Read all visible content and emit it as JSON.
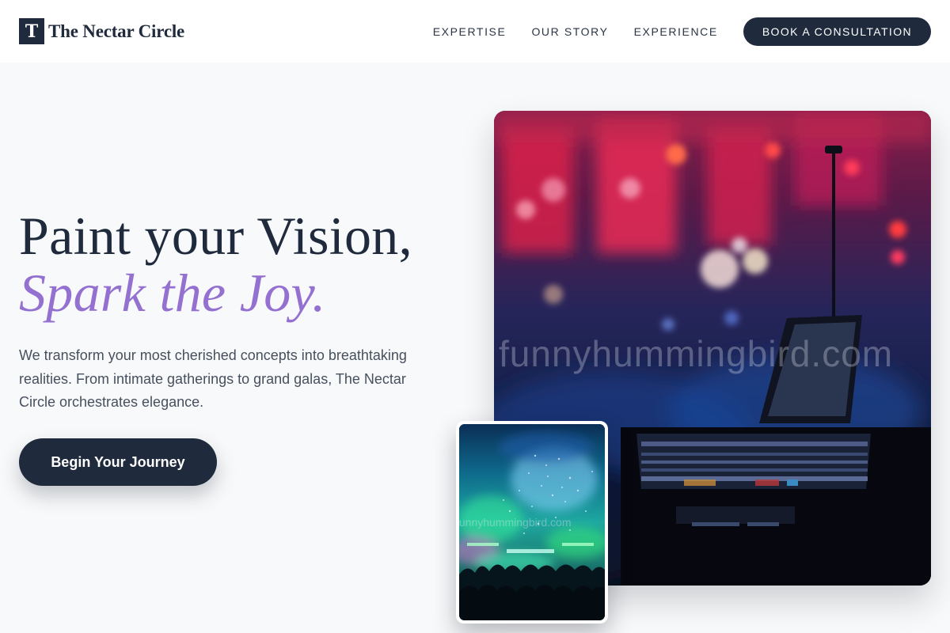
{
  "brand": {
    "mark": "T",
    "name": "The Nectar Circle"
  },
  "nav": {
    "items": [
      {
        "label": "EXPERTISE"
      },
      {
        "label": "OUR STORY"
      },
      {
        "label": "EXPERIENCE"
      }
    ],
    "cta_label": "BOOK A CONSULTATION"
  },
  "hero": {
    "title_line1": "Paint your Vision,",
    "title_line2": "Spark the Joy.",
    "description": "We transform your most cherished concepts into breathtaking realities. From intimate gatherings to grand galas, The Nectar Circle orchestrates elegance.",
    "cta_label": "Begin Your Journey"
  },
  "images": {
    "main_watermark": "funnyhummingbird.com",
    "card_watermark": "funnyhummingbird.com"
  },
  "colors": {
    "navy": "#1f2a3d",
    "accent_purple": "#9470d1",
    "page_background": "#f8f9fa"
  }
}
